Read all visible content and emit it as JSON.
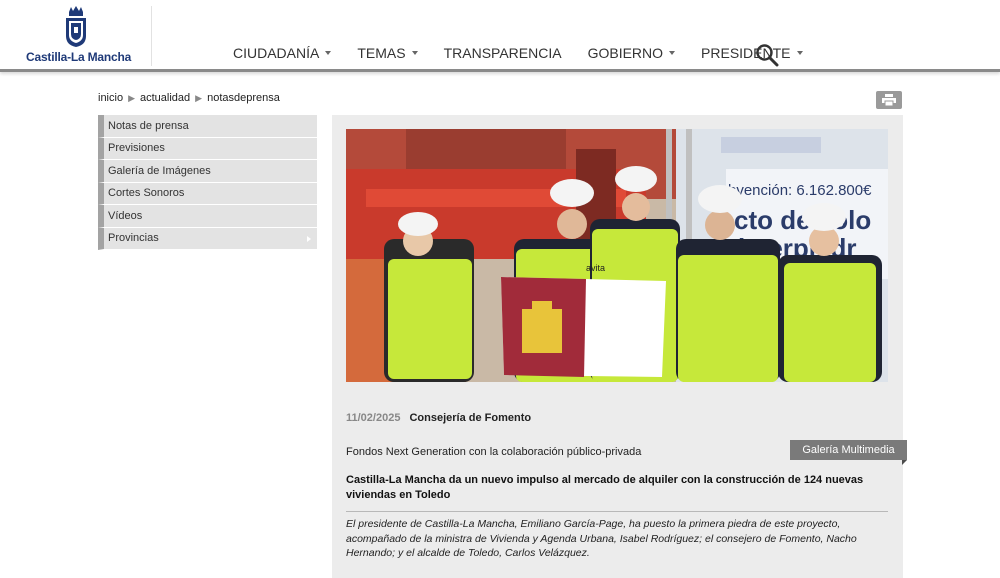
{
  "header": {
    "logo_text": "Castilla-La Mancha",
    "nav": [
      {
        "label": "CIUDADANÍA",
        "dropdown": true
      },
      {
        "label": "TEMAS",
        "dropdown": true
      },
      {
        "label": "TRANSPARENCIA",
        "dropdown": false
      },
      {
        "label": "GOBIERNO",
        "dropdown": true
      },
      {
        "label": "PRESIDENTE",
        "dropdown": true
      }
    ],
    "search_icon": "search-icon"
  },
  "breadcrumb": [
    "inicio",
    "actualidad",
    "notasdeprensa"
  ],
  "print_icon": "print-icon",
  "sidebar": {
    "items": [
      {
        "label": "Notas de prensa"
      },
      {
        "label": "Previsiones"
      },
      {
        "label": "Galería de Imágenes"
      },
      {
        "label": "Cortes Sonoros"
      },
      {
        "label": "Vídeos"
      },
      {
        "label": "Provincias",
        "submenu": true
      }
    ]
  },
  "article": {
    "photo_banner_text": "bvención: 6.162.800€",
    "photo_banner_text2": "cto de colo",
    "photo_banner_text3": "imerpiedr",
    "vest_text": "avita",
    "date": "11/02/2025",
    "department": "Consejería de Fomento",
    "subtitle": "Fondos Next Generation con la colaboración público-privada",
    "gallery_button": "Galería Multimedia",
    "headline": "Castilla-La Mancha da un nuevo impulso al mercado de alquiler con la construcción de 124 nuevas viviendas en Toledo",
    "summary": "El presidente de Castilla-La Mancha, Emiliano García-Page, ha puesto la primera piedra de este proyecto, acompañado de la ministra de Vivienda y Agenda Urbana, Isabel Rodríguez; el consejero de Fomento, Nacho Hernando; y el alcalde de Toledo, Carlos Velázquez."
  },
  "colors": {
    "brand_blue": "#1f3a78",
    "sidebar_bg": "#e3e3e3",
    "sidebar_accent": "#a3a3a3",
    "panel_bg": "#ececec",
    "gallery_button_bg": "#7a7a7a"
  }
}
